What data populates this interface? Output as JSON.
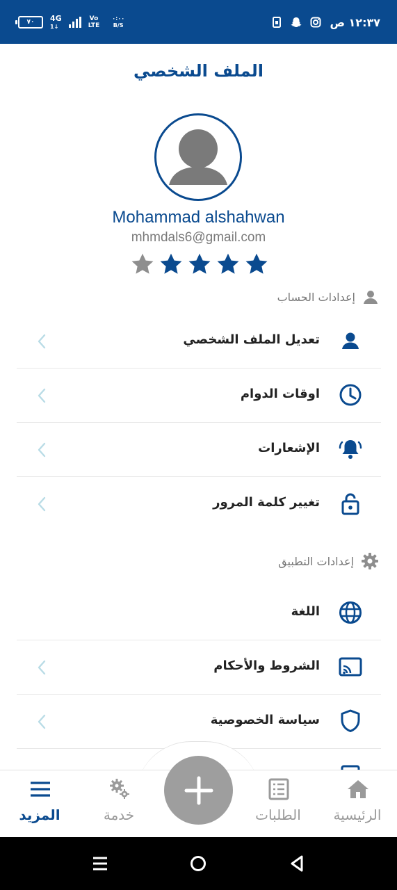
{
  "status_bar": {
    "battery": "٧٠",
    "network": "4G",
    "network_sub": "1↓",
    "volte_top": "Vo",
    "volte_bottom": "LTE",
    "speed_top": "٠:٠٠",
    "speed_bottom": "B/S",
    "time": "١٢:٣٧ ص",
    "icons": [
      "sim-icon",
      "snapchat-icon",
      "instagram-icon"
    ]
  },
  "header": {
    "title": "الملف الشخصي"
  },
  "profile": {
    "name": "Mohammad alshahwan",
    "email": "mhmdals6@gmail.com",
    "rating": 4,
    "rating_max": 5
  },
  "account_section": {
    "title": "إعدادات الحساب",
    "items": [
      {
        "label": "تعديل الملف الشخصي",
        "icon": "person-icon"
      },
      {
        "label": "اوقات الدوام",
        "icon": "clock-icon"
      },
      {
        "label": "الإشعارات",
        "icon": "bell-icon"
      },
      {
        "label": "تغيير كلمة المرور",
        "icon": "lock-icon"
      }
    ]
  },
  "app_section": {
    "title": "إعدادات التطبيق",
    "items": [
      {
        "label": "اللغة",
        "icon": "globe-icon"
      },
      {
        "label": "الشروط والأحكام",
        "icon": "cast-icon"
      },
      {
        "label": "سياسة الخصوصية",
        "icon": "shield-icon"
      }
    ]
  },
  "bottom_nav": {
    "items": [
      {
        "label": "الرئيسية",
        "icon": "home-icon"
      },
      {
        "label": "الطلبات",
        "icon": "orders-icon"
      },
      {
        "label": "خدمة",
        "icon": "gears-icon"
      },
      {
        "label": "المزيد",
        "icon": "menu-icon"
      }
    ],
    "active": "المزيد"
  },
  "colors": {
    "primary": "#0a4a8f",
    "chevron": "#b9dce6",
    "inactive": "#9a9a9a",
    "fab": "#9e9e9e"
  }
}
